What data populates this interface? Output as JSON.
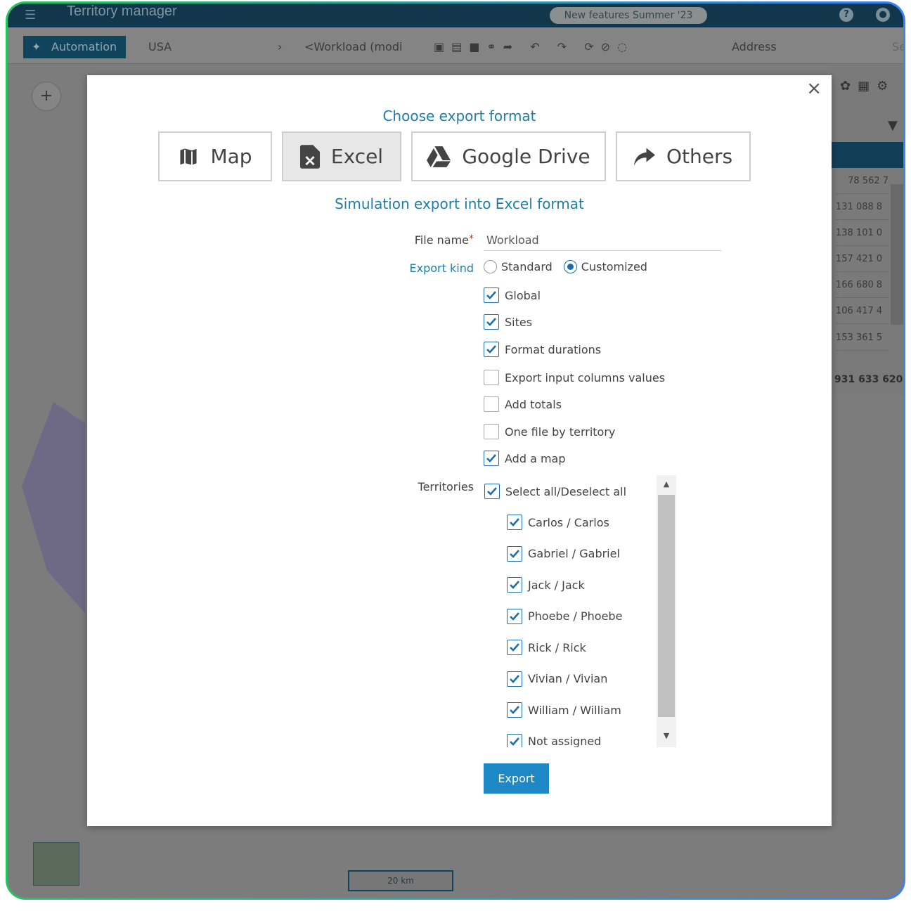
{
  "app": {
    "logo": "Territory manager",
    "news_badge": "New features Summer '23"
  },
  "toolbar": {
    "automation": "Automation",
    "country": "USA",
    "breadcrumb": "<Workload (modi",
    "address": "Address",
    "search_partial": "Se"
  },
  "right_panel": {
    "values": [
      "78 562 7",
      "131 088 8",
      "138 101 0",
      "157 421 0",
      "166 680 8",
      "106 417 4",
      "153 361 5"
    ],
    "total": "931 633 620"
  },
  "map": {
    "scale": "20 km"
  },
  "dialog": {
    "title": "Choose export format",
    "formats": [
      {
        "label": "Map",
        "icon": "map-icon"
      },
      {
        "label": "Excel",
        "icon": "excel-file-icon",
        "selected": true
      },
      {
        "label": "Google Drive",
        "icon": "google-drive-icon"
      },
      {
        "label": "Others",
        "icon": "share-arrow-icon"
      }
    ],
    "subtitle": "Simulation export into Excel format",
    "file_name_label": "File name",
    "required_mark": "*",
    "file_name_value": "Workload",
    "export_kind_label": "Export kind",
    "export_kind_options": [
      {
        "label": "Standard",
        "selected": false
      },
      {
        "label": "Customized",
        "selected": true
      }
    ],
    "options": [
      {
        "label": "Global",
        "checked": true
      },
      {
        "label": "Sites",
        "checked": true
      },
      {
        "label": "Format durations",
        "checked": true
      },
      {
        "label": "Export input columns values",
        "checked": false
      },
      {
        "label": "Add totals",
        "checked": false
      },
      {
        "label": "One file by territory",
        "checked": false
      },
      {
        "label": "Add a map",
        "checked": true
      }
    ],
    "territories_label": "Territories",
    "select_all": "Select all/Deselect all",
    "territories": [
      "Carlos / Carlos",
      "Gabriel / Gabriel",
      "Jack / Jack",
      "Phoebe / Phoebe",
      "Rick / Rick",
      "Vivian / Vivian",
      "William / William",
      "Not assigned"
    ],
    "export_button": "Export"
  },
  "colors": {
    "accent": "#1f7ea6",
    "button": "#1e88c7",
    "checkbox": "#1e6fa8"
  }
}
